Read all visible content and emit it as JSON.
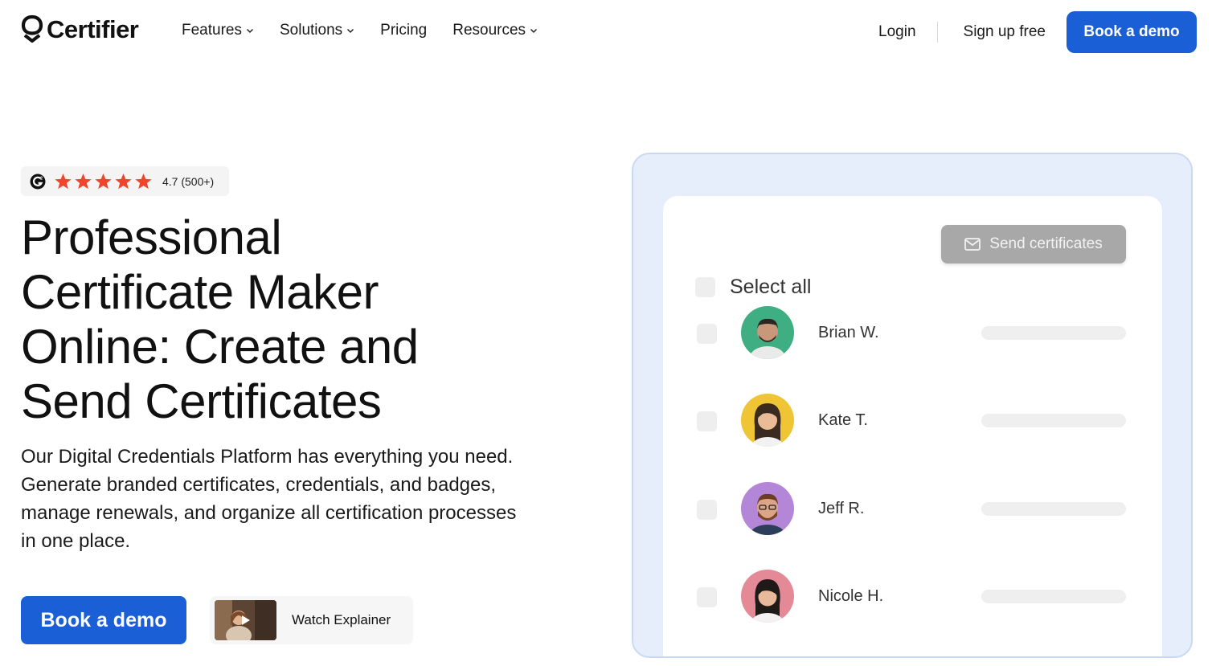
{
  "brand": {
    "name": "Certifier",
    "accent": "#1a5fd6",
    "icon": "certifier-logo-icon"
  },
  "nav": {
    "links": [
      {
        "label": "Features",
        "dropdown": true
      },
      {
        "label": "Solutions",
        "dropdown": true
      },
      {
        "label": "Pricing",
        "dropdown": false
      },
      {
        "label": "Resources",
        "dropdown": true
      }
    ],
    "login": "Login",
    "signup": "Sign up free",
    "book_demo": "Book a demo"
  },
  "hero": {
    "rating": {
      "source_icon": "g2-icon",
      "stars": 5,
      "text": "4.7 (500+)"
    },
    "title_lines": [
      "Professional",
      "Certificate Maker",
      "Online: Create and",
      "Send Certificates"
    ],
    "description": "Our Digital Credentials Platform has everything you need. Generate branded certificates, credentials, and badges, manage renewals, and organize all certification processes in one place.",
    "cta_primary": "Book a demo",
    "cta_secondary": "Watch Explainer"
  },
  "preview": {
    "select_all": "Select all",
    "send_button": "Send certificates",
    "recipients": [
      {
        "name": "Brian W.",
        "avatar_bg": "#3fae83"
      },
      {
        "name": "Kate T.",
        "avatar_bg": "#efc435"
      },
      {
        "name": "Jeff R.",
        "avatar_bg": "#b486d8"
      },
      {
        "name": "Nicole H.",
        "avatar_bg": "#e48a96"
      }
    ]
  }
}
